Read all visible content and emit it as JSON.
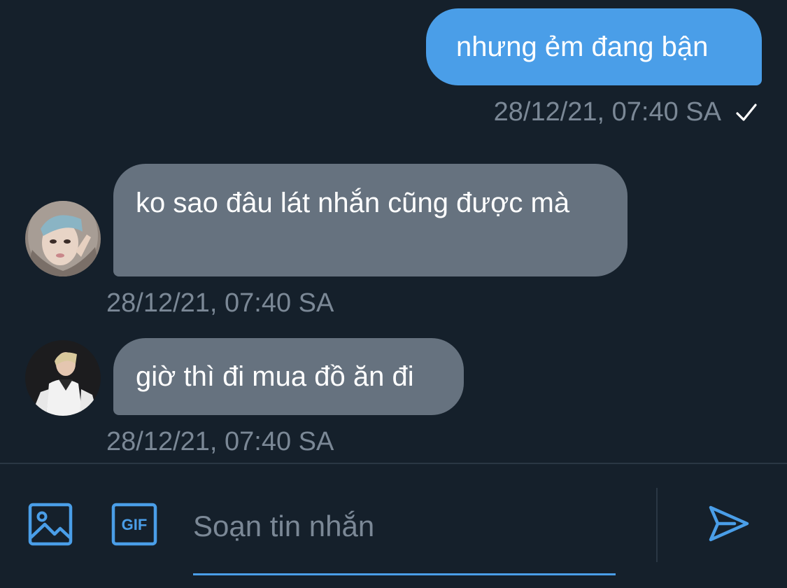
{
  "messages": [
    {
      "direction": "sent",
      "text": "nhưng ẻm đang bận",
      "timestamp": "28/12/21, 07:40 SA",
      "status_icon": "checkmark-icon"
    },
    {
      "direction": "received",
      "text": "ko sao đâu lát nhắn cũng được mà",
      "timestamp": "28/12/21, 07:40 SA",
      "avatar": "avatar-hooded-person"
    },
    {
      "direction": "received",
      "text": "giờ thì đi mua đồ ăn đi",
      "timestamp": "28/12/21, 07:40 SA",
      "avatar": "avatar-person-white-jacket"
    }
  ],
  "composer": {
    "placeholder": "Soạn tin nhắn",
    "value": "",
    "media_icon": "image-icon",
    "gif_icon": "gif-icon",
    "gif_label": "GIF",
    "send_icon": "send-icon"
  },
  "colors": {
    "background": "#15202b",
    "sent_bubble": "#4a9ee8",
    "received_bubble": "#66727f",
    "meta_text": "#7b8896",
    "accent": "#4a9ee8"
  }
}
